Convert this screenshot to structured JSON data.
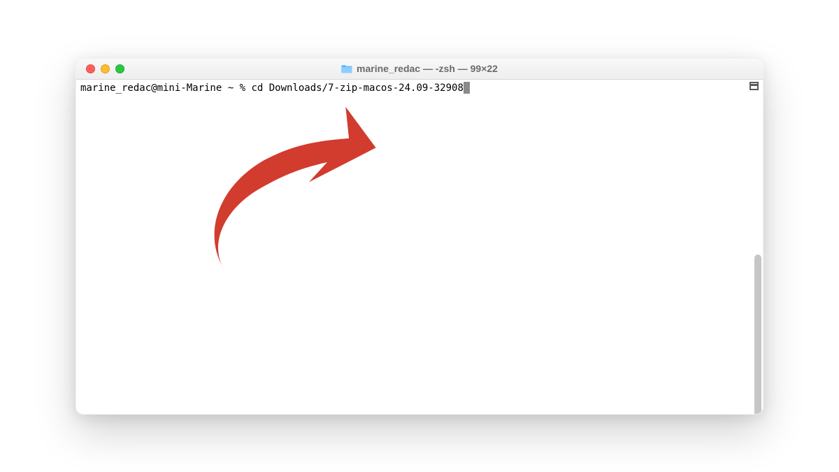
{
  "window": {
    "title": "marine_redac — -zsh — 99×22"
  },
  "terminal": {
    "prompt": "marine_redac@mini-Marine ~ % ",
    "command": "cd Downloads/7-zip-macos-24.09-32908"
  },
  "colors": {
    "arrow": "#d13c2f"
  }
}
